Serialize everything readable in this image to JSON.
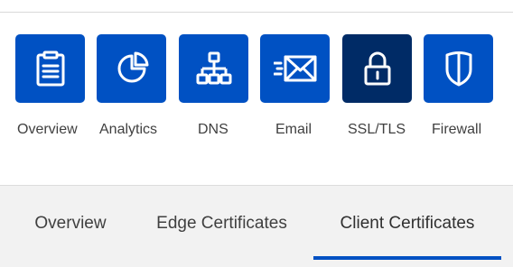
{
  "colors": {
    "accent": "#0051c3",
    "accent_active": "#002b66",
    "tab_bar_bg": "#f2f2f2",
    "text": "#404040"
  },
  "app_nav": {
    "items": [
      {
        "label": "Overview",
        "icon": "clipboard-icon",
        "active": false
      },
      {
        "label": "Analytics",
        "icon": "pie-chart-icon",
        "active": false
      },
      {
        "label": "DNS",
        "icon": "network-icon",
        "active": false
      },
      {
        "label": "Email",
        "icon": "envelope-icon",
        "active": false
      },
      {
        "label": "SSL/TLS",
        "icon": "lock-icon",
        "active": true
      },
      {
        "label": "Firewall",
        "icon": "shield-icon",
        "active": false
      }
    ]
  },
  "sub_tabs": {
    "items": [
      {
        "label": "Overview",
        "active": false
      },
      {
        "label": "Edge Certificates",
        "active": false
      },
      {
        "label": "Client Certificates",
        "active": true
      }
    ]
  }
}
